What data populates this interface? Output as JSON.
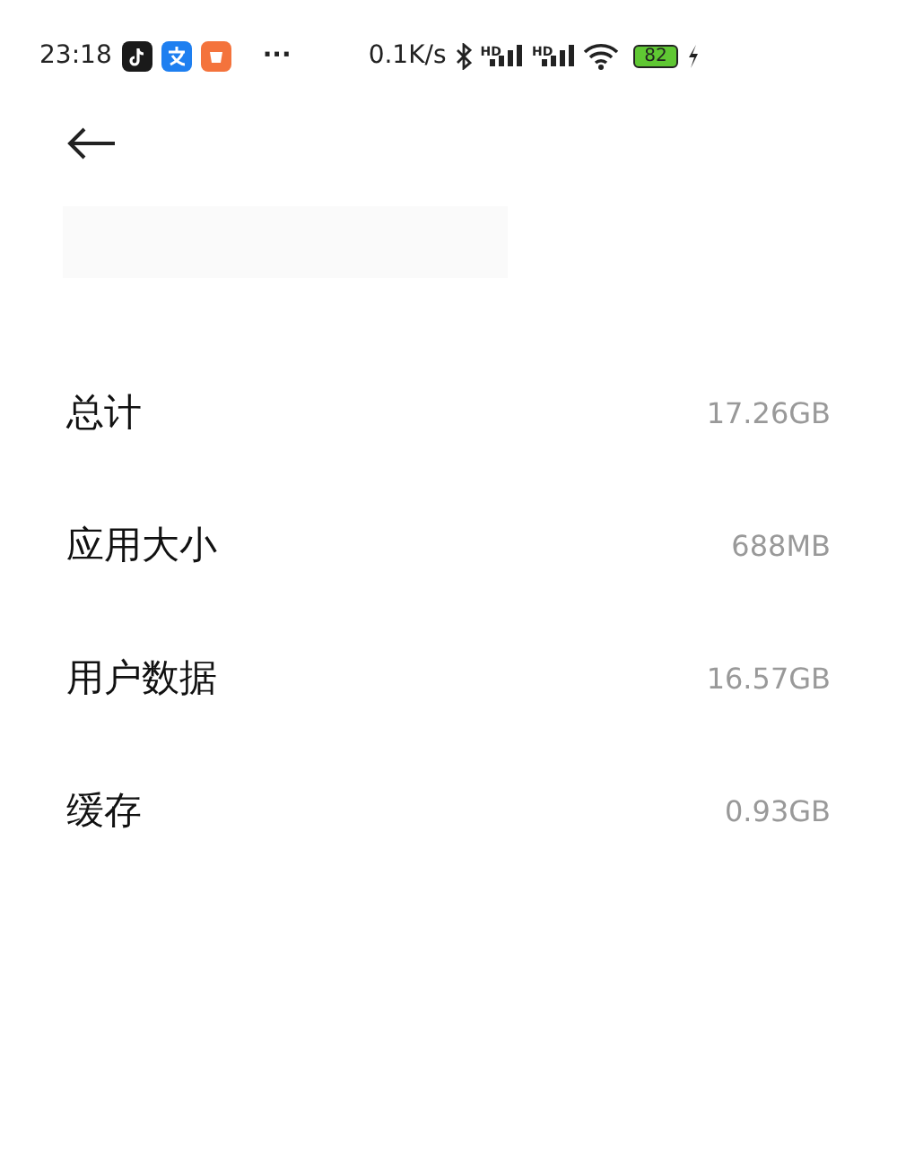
{
  "status_bar": {
    "time": "23:18",
    "more": "···",
    "speed": "0.1K/s",
    "signals": [
      {
        "label": "HD"
      },
      {
        "label": "HD"
      }
    ],
    "battery": "82"
  },
  "rows": [
    {
      "label": "总计",
      "value": "17.26GB"
    },
    {
      "label": "应用大小",
      "value": "688MB"
    },
    {
      "label": "用户数据",
      "value": "16.57GB"
    },
    {
      "label": "缓存",
      "value": "0.93GB"
    }
  ]
}
